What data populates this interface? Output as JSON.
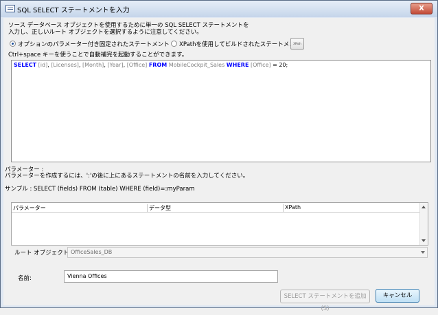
{
  "window": {
    "title": "SQL SELECT ステートメントを入力",
    "close_symbol": "X"
  },
  "intro": {
    "line1": "ソース データベース オブジェクトを使用するために単一の SQL SELECT ステートメントを",
    "line2": "入力し、正しいルート オブジェクトを選択するように注意してください。"
  },
  "options": {
    "fixed_statement_label": "オプションのパラメーター付き固定されたステートメント",
    "fixed_statement_selected": true,
    "xpath_statement_label": "XPathを使用してビルドされたステートメント",
    "xpath_statement_selected": false,
    "xpath_button_label": "XPath"
  },
  "hint": "Ctrl+space キーを使うことで自動補完を起動することができます。",
  "sql": {
    "tokens": [
      {
        "t": "SELECT",
        "c": "kw"
      },
      {
        "t": " ",
        "c": ""
      },
      {
        "t": "[id]",
        "c": "id"
      },
      {
        "t": ", ",
        "c": ""
      },
      {
        "t": "[Licenses]",
        "c": "id"
      },
      {
        "t": ", ",
        "c": ""
      },
      {
        "t": "[Month]",
        "c": "id"
      },
      {
        "t": ", ",
        "c": ""
      },
      {
        "t": "[Year]",
        "c": "id"
      },
      {
        "t": ", ",
        "c": ""
      },
      {
        "t": "[Office]",
        "c": "id"
      },
      {
        "t": " ",
        "c": ""
      },
      {
        "t": "FROM",
        "c": "kw"
      },
      {
        "t": " ",
        "c": ""
      },
      {
        "t": "MobileCockpit_Sales",
        "c": "id"
      },
      {
        "t": " ",
        "c": ""
      },
      {
        "t": "WHERE",
        "c": "kw"
      },
      {
        "t": " ",
        "c": ""
      },
      {
        "t": "[Office]",
        "c": "id"
      },
      {
        "t": " = ",
        "c": ""
      },
      {
        "t": "20",
        "c": "num"
      },
      {
        "t": ";",
        "c": ""
      }
    ]
  },
  "parameters": {
    "heading": "パラメーター :",
    "description": "パラメーターを作成するには、':'の後に上にあるステートメントの名前を入力してください。",
    "sample": "サンプル : SELECT (fields) FROM (table) WHERE (field)=:myParam",
    "columns": [
      "パラメーター",
      "データ型",
      "XPath"
    ]
  },
  "root_object": {
    "label": "ルート オブジェクト:",
    "value": "OfficeSales_DB"
  },
  "name": {
    "label": "名前:",
    "value": "Vienna Offices"
  },
  "buttons": {
    "add_label": "SELECT ステートメントを追加(S)",
    "cancel_label": "キャンセル"
  }
}
